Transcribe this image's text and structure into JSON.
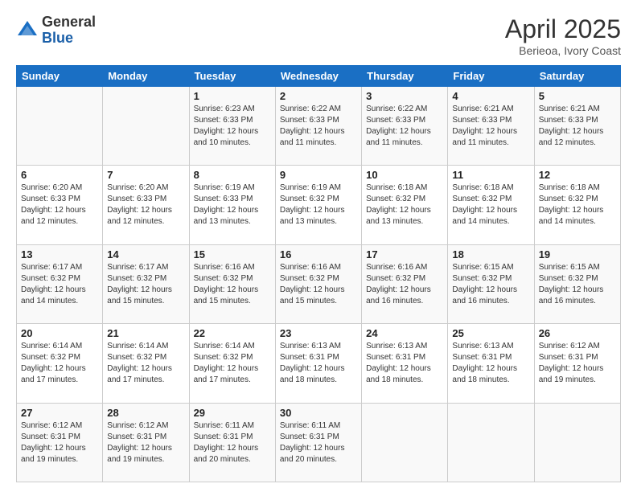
{
  "header": {
    "logo_general": "General",
    "logo_blue": "Blue",
    "title": "April 2025",
    "location": "Berieoa, Ivory Coast"
  },
  "days_of_week": [
    "Sunday",
    "Monday",
    "Tuesday",
    "Wednesday",
    "Thursday",
    "Friday",
    "Saturday"
  ],
  "weeks": [
    [
      {
        "day": "",
        "info": ""
      },
      {
        "day": "",
        "info": ""
      },
      {
        "day": "1",
        "info": "Sunrise: 6:23 AM\nSunset: 6:33 PM\nDaylight: 12 hours and 10 minutes."
      },
      {
        "day": "2",
        "info": "Sunrise: 6:22 AM\nSunset: 6:33 PM\nDaylight: 12 hours and 11 minutes."
      },
      {
        "day": "3",
        "info": "Sunrise: 6:22 AM\nSunset: 6:33 PM\nDaylight: 12 hours and 11 minutes."
      },
      {
        "day": "4",
        "info": "Sunrise: 6:21 AM\nSunset: 6:33 PM\nDaylight: 12 hours and 11 minutes."
      },
      {
        "day": "5",
        "info": "Sunrise: 6:21 AM\nSunset: 6:33 PM\nDaylight: 12 hours and 12 minutes."
      }
    ],
    [
      {
        "day": "6",
        "info": "Sunrise: 6:20 AM\nSunset: 6:33 PM\nDaylight: 12 hours and 12 minutes."
      },
      {
        "day": "7",
        "info": "Sunrise: 6:20 AM\nSunset: 6:33 PM\nDaylight: 12 hours and 12 minutes."
      },
      {
        "day": "8",
        "info": "Sunrise: 6:19 AM\nSunset: 6:33 PM\nDaylight: 12 hours and 13 minutes."
      },
      {
        "day": "9",
        "info": "Sunrise: 6:19 AM\nSunset: 6:32 PM\nDaylight: 12 hours and 13 minutes."
      },
      {
        "day": "10",
        "info": "Sunrise: 6:18 AM\nSunset: 6:32 PM\nDaylight: 12 hours and 13 minutes."
      },
      {
        "day": "11",
        "info": "Sunrise: 6:18 AM\nSunset: 6:32 PM\nDaylight: 12 hours and 14 minutes."
      },
      {
        "day": "12",
        "info": "Sunrise: 6:18 AM\nSunset: 6:32 PM\nDaylight: 12 hours and 14 minutes."
      }
    ],
    [
      {
        "day": "13",
        "info": "Sunrise: 6:17 AM\nSunset: 6:32 PM\nDaylight: 12 hours and 14 minutes."
      },
      {
        "day": "14",
        "info": "Sunrise: 6:17 AM\nSunset: 6:32 PM\nDaylight: 12 hours and 15 minutes."
      },
      {
        "day": "15",
        "info": "Sunrise: 6:16 AM\nSunset: 6:32 PM\nDaylight: 12 hours and 15 minutes."
      },
      {
        "day": "16",
        "info": "Sunrise: 6:16 AM\nSunset: 6:32 PM\nDaylight: 12 hours and 15 minutes."
      },
      {
        "day": "17",
        "info": "Sunrise: 6:16 AM\nSunset: 6:32 PM\nDaylight: 12 hours and 16 minutes."
      },
      {
        "day": "18",
        "info": "Sunrise: 6:15 AM\nSunset: 6:32 PM\nDaylight: 12 hours and 16 minutes."
      },
      {
        "day": "19",
        "info": "Sunrise: 6:15 AM\nSunset: 6:32 PM\nDaylight: 12 hours and 16 minutes."
      }
    ],
    [
      {
        "day": "20",
        "info": "Sunrise: 6:14 AM\nSunset: 6:32 PM\nDaylight: 12 hours and 17 minutes."
      },
      {
        "day": "21",
        "info": "Sunrise: 6:14 AM\nSunset: 6:32 PM\nDaylight: 12 hours and 17 minutes."
      },
      {
        "day": "22",
        "info": "Sunrise: 6:14 AM\nSunset: 6:32 PM\nDaylight: 12 hours and 17 minutes."
      },
      {
        "day": "23",
        "info": "Sunrise: 6:13 AM\nSunset: 6:31 PM\nDaylight: 12 hours and 18 minutes."
      },
      {
        "day": "24",
        "info": "Sunrise: 6:13 AM\nSunset: 6:31 PM\nDaylight: 12 hours and 18 minutes."
      },
      {
        "day": "25",
        "info": "Sunrise: 6:13 AM\nSunset: 6:31 PM\nDaylight: 12 hours and 18 minutes."
      },
      {
        "day": "26",
        "info": "Sunrise: 6:12 AM\nSunset: 6:31 PM\nDaylight: 12 hours and 19 minutes."
      }
    ],
    [
      {
        "day": "27",
        "info": "Sunrise: 6:12 AM\nSunset: 6:31 PM\nDaylight: 12 hours and 19 minutes."
      },
      {
        "day": "28",
        "info": "Sunrise: 6:12 AM\nSunset: 6:31 PM\nDaylight: 12 hours and 19 minutes."
      },
      {
        "day": "29",
        "info": "Sunrise: 6:11 AM\nSunset: 6:31 PM\nDaylight: 12 hours and 20 minutes."
      },
      {
        "day": "30",
        "info": "Sunrise: 6:11 AM\nSunset: 6:31 PM\nDaylight: 12 hours and 20 minutes."
      },
      {
        "day": "",
        "info": ""
      },
      {
        "day": "",
        "info": ""
      },
      {
        "day": "",
        "info": ""
      }
    ]
  ]
}
